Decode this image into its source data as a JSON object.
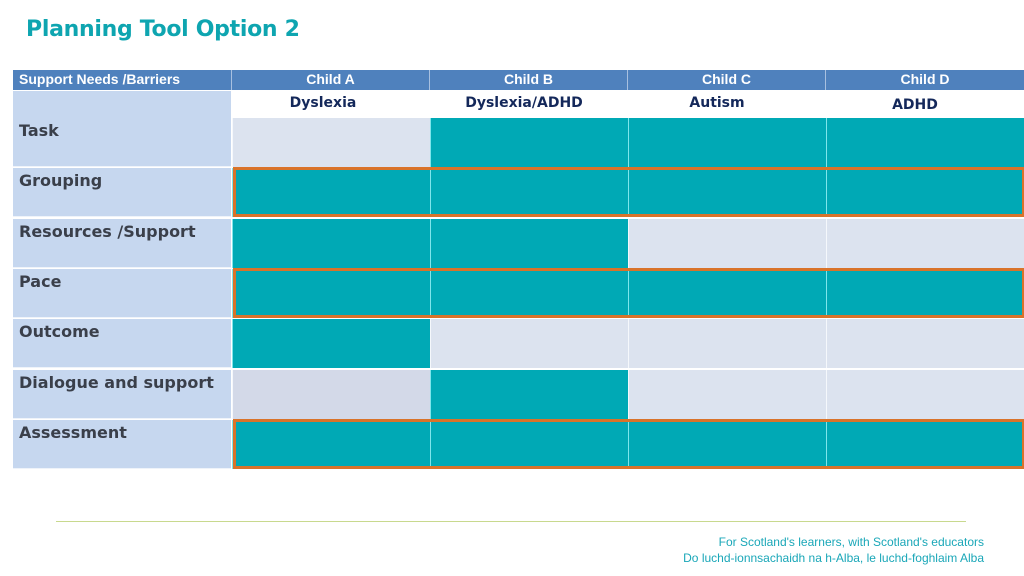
{
  "title": "Planning Tool Option 2",
  "table": {
    "corner_header": "Support Needs /Barriers",
    "columns": [
      {
        "label": "Child A",
        "need": "Dyslexia"
      },
      {
        "label": "Child B",
        "need": "Dyslexia/ADHD"
      },
      {
        "label": "Child C",
        "need": "Autism"
      },
      {
        "label": "Child D",
        "need": "ADHD"
      }
    ],
    "rows": [
      {
        "label": "Task",
        "filled": [
          false,
          true,
          true,
          true
        ],
        "highlighted": false
      },
      {
        "label": "Grouping",
        "filled": [
          true,
          true,
          true,
          true
        ],
        "highlighted": true
      },
      {
        "label": "Resources /Support",
        "filled": [
          true,
          true,
          false,
          false
        ],
        "highlighted": false
      },
      {
        "label": "Pace",
        "filled": [
          true,
          true,
          true,
          true
        ],
        "highlighted": true
      },
      {
        "label": "Outcome",
        "filled": [
          true,
          false,
          false,
          false
        ],
        "highlighted": false
      },
      {
        "label": "Dialogue and support",
        "filled": [
          false,
          true,
          false,
          false
        ],
        "highlighted": false
      },
      {
        "label": "Assessment",
        "filled": [
          true,
          true,
          true,
          true
        ],
        "highlighted": true
      }
    ],
    "colors": {
      "header": "#4f81bd",
      "filled": "#00a9b5",
      "empty": "#dce3ef",
      "label_bg": "#c6d7ef",
      "highlight": "#d9732a"
    }
  },
  "footer": {
    "line1": "For Scotland's learners, with Scotland's educators",
    "line2": "Do luchd-ionnsachaidh na h-Alba, le luchd-foghlaim Alba"
  }
}
